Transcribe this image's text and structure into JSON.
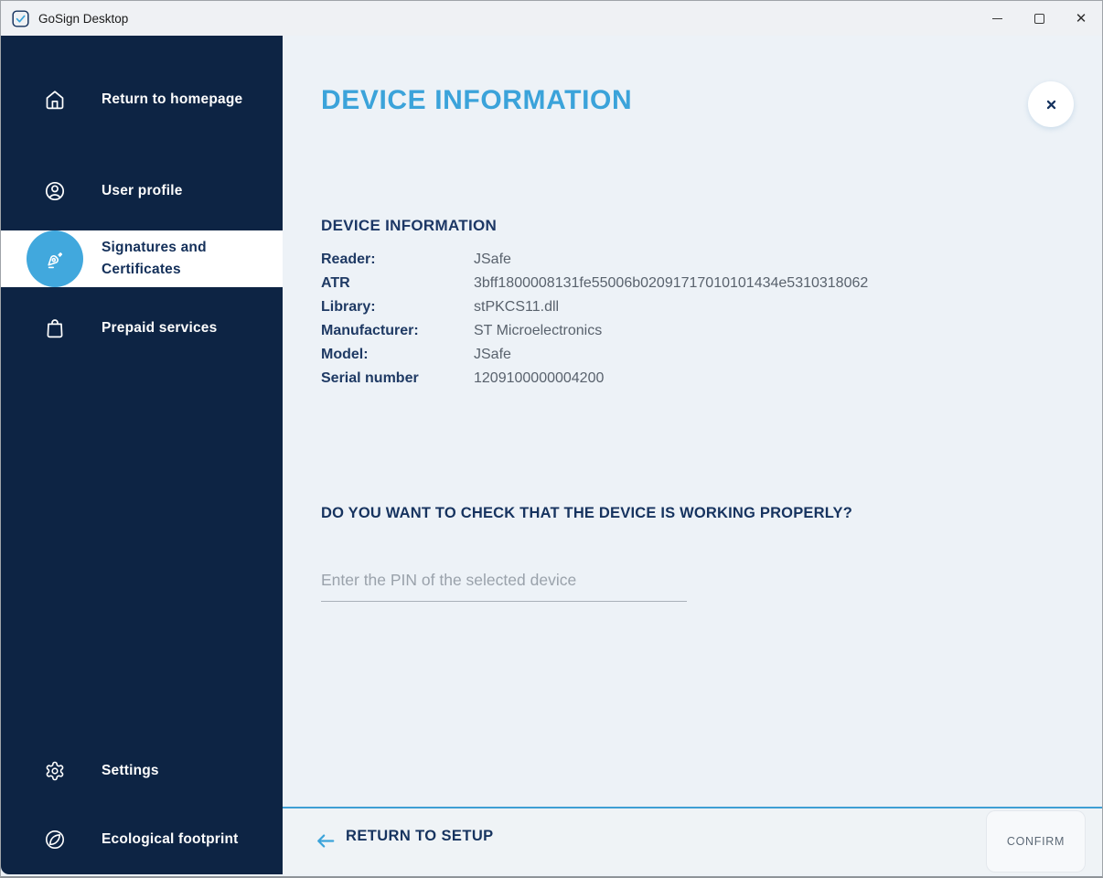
{
  "titlebar": {
    "app_title": "GoSign Desktop"
  },
  "sidebar": {
    "items": [
      {
        "label": "Return to homepage",
        "icon": "home-icon",
        "active": false
      },
      {
        "label": "User profile",
        "icon": "user-circle-icon",
        "active": false
      },
      {
        "label": "Signatures and Certificates",
        "icon": "pen-nib-icon",
        "active": true
      },
      {
        "label": "Prepaid services",
        "icon": "shopping-bag-icon",
        "active": false
      }
    ],
    "bottom_items": [
      {
        "label": "Settings",
        "icon": "gear-icon",
        "active": false
      },
      {
        "label": "Ecological footprint",
        "icon": "leaf-icon",
        "active": false
      }
    ]
  },
  "main": {
    "page_title": "DEVICE INFORMATION",
    "device_info": {
      "heading": "DEVICE INFORMATION",
      "rows": [
        {
          "label": "Reader:",
          "value": "JSafe"
        },
        {
          "label": "ATR",
          "value": "3bff1800008131fe55006b02091717010101434e5310318062"
        },
        {
          "label": "Library:",
          "value": "stPKCS11.dll"
        },
        {
          "label": "Manufacturer:",
          "value": "ST Microelectronics"
        },
        {
          "label": "Model:",
          "value": "JSafe"
        },
        {
          "label": "Serial number",
          "value": "1209100000004200"
        }
      ]
    },
    "question": "DO YOU WANT TO CHECK THAT THE DEVICE IS WORKING PROPERLY?",
    "pin_input": {
      "placeholder": "Enter the PIN of the selected device",
      "value": ""
    }
  },
  "footer": {
    "back_label": "RETURN TO SETUP",
    "confirm_label": "CONFIRM"
  },
  "colors": {
    "accent_blue": "#3ba3da",
    "active_circle_blue": "#41a8dd",
    "sidebar_navy": "#0d2444",
    "text_navy": "#1c3765",
    "value_gray": "#59626d",
    "footer_divider_blue": "#3f9fd4",
    "main_background": "#edf2f7"
  }
}
